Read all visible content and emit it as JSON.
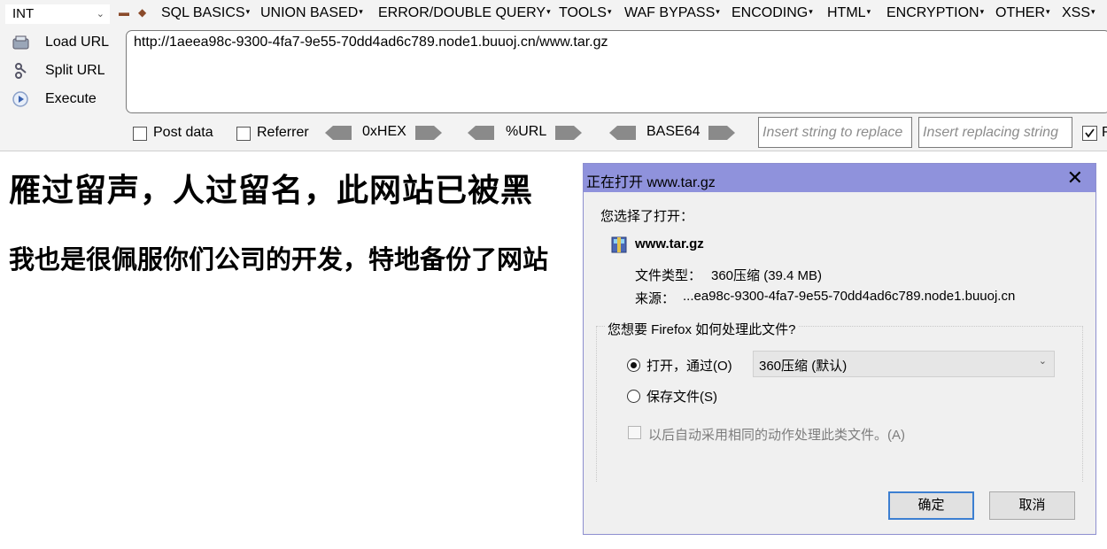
{
  "hackbar": {
    "injection_type": "INT",
    "menus": [
      "SQL BASICS",
      "UNION BASED",
      "ERROR/DOUBLE QUERY",
      "TOOLS",
      "WAF BYPASS",
      "ENCODING",
      "HTML",
      "ENCRYPTION",
      "OTHER",
      "XSS"
    ],
    "load_url": "Load URL",
    "split_url": "Split URL",
    "execute": "Execute",
    "url": "http://1aeea98c-9300-4fa7-9e55-70dd4ad6c789.node1.buuoj.cn/www.tar.gz",
    "post_data": "Post data",
    "referrer": "Referrer",
    "hex": "0xHEX",
    "urlenc": "%URL",
    "base64": "BASE64",
    "insert_replace_placeholder": "Insert string to replace",
    "insert_replacing_placeholder": "Insert replacing string",
    "last_checkbox_label": "R"
  },
  "page": {
    "heading1": "雁过留声，人过留名，此网站已被黑",
    "heading2": "我也是很佩服你们公司的开发，特地备份了网站"
  },
  "dialog": {
    "title": "正在打开 www.tar.gz",
    "chosen_label": "您选择了打开：",
    "filename": "www.tar.gz",
    "type_label": "文件类型：",
    "type_value": "360压缩 (39.4 MB)",
    "source_label": "来源：",
    "source_value": "...ea98c-9300-4fa7-9e55-70dd4ad6c789.node1.buuoj.cn",
    "question": "您想要 Firefox 如何处理此文件?",
    "open_with_label": "打开，通过(O)",
    "open_with_app": "360压缩 (默认)",
    "save_file_label": "保存文件(S)",
    "auto_label": "以后自动采用相同的动作处理此类文件。(A)",
    "ok": "确定",
    "cancel": "取消",
    "selected_option": "open"
  }
}
